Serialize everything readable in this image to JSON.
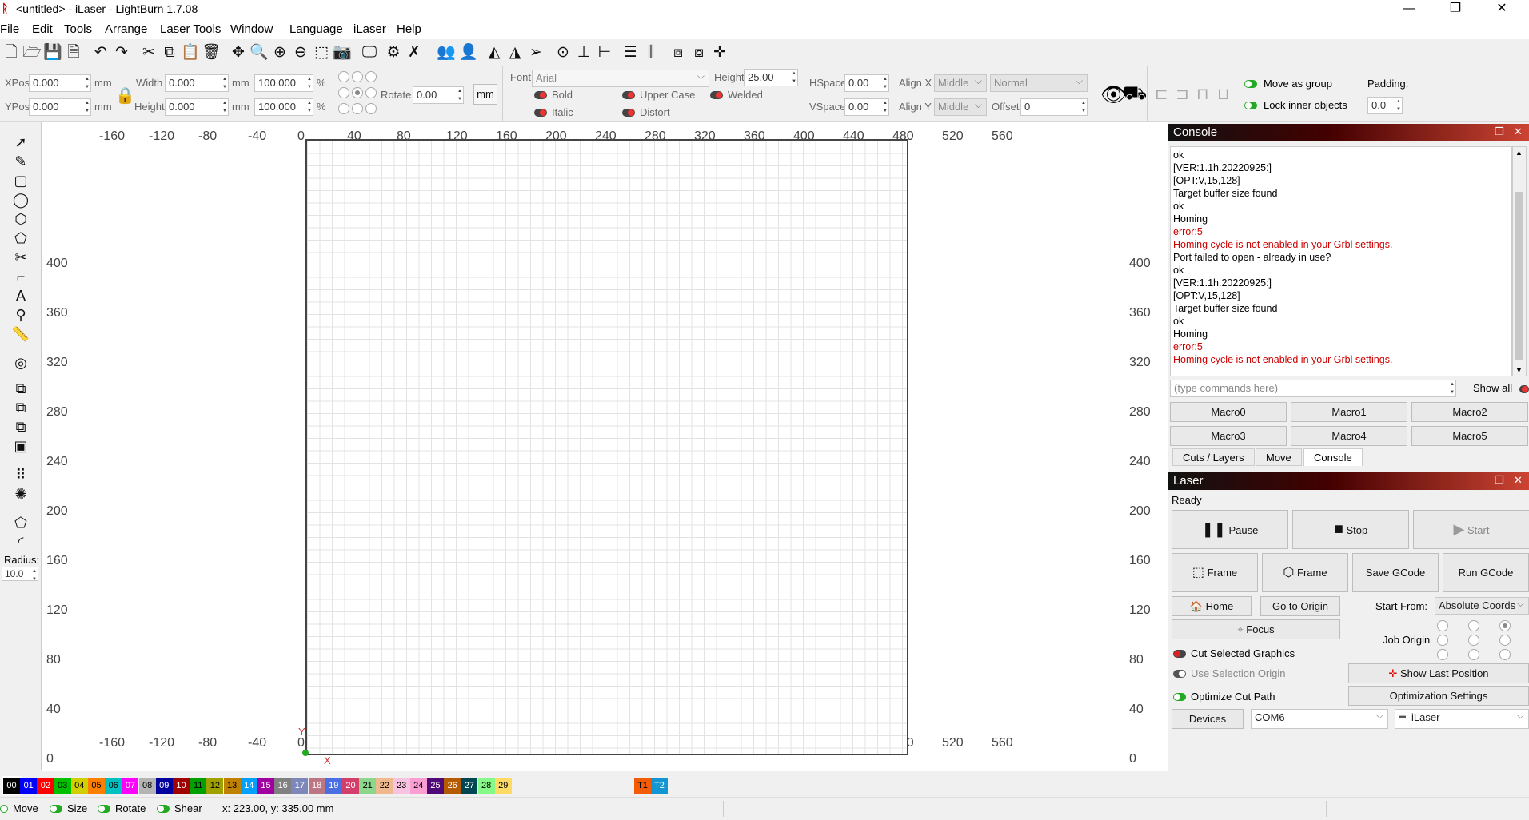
{
  "window": {
    "title": "<untitled> - iLaser - LightBurn 1.7.08",
    "minimize": "—",
    "restore": "❐",
    "close": "✕"
  },
  "menu": [
    "File",
    "Edit",
    "Tools",
    "Arrange",
    "Laser Tools",
    "Window",
    "Language",
    "iLaser",
    "Help"
  ],
  "toolbar_icons": [
    "new-file-icon",
    "open-folder-icon",
    "save-icon",
    "save-as-icon",
    "undo-icon",
    "redo-icon",
    "cut-icon",
    "copy-icon",
    "paste-icon",
    "delete-icon",
    "move-icon",
    "zoom-in-icon",
    "zoom-fit-icon",
    "zoom-out-icon",
    "zoom-selection-icon",
    "frame-select-icon",
    "camera-icon",
    "monitor-icon",
    "settings-gear-icon",
    "tools-icon",
    "group-icon",
    "user-icon",
    "mirror-icon",
    "flip-icon",
    "send-icon",
    "target-icon",
    "align-center-icon",
    "align-middle-icon",
    "distribute-h-icon",
    "distribute-v-icon",
    "space-icon",
    "crosshair-icon"
  ],
  "position": {
    "xpos_label": "XPos",
    "xpos": "0.000",
    "ypos_label": "YPos",
    "ypos": "0.000",
    "unit": "mm"
  },
  "size": {
    "width_label": "Width",
    "width": "0.000",
    "height_label": "Height",
    "height": "0.000",
    "unit": "mm",
    "w_pct": "100.000",
    "h_pct": "100.000",
    "pct": "%"
  },
  "rotate": {
    "label": "Rotate",
    "value": "0.00",
    "unit_btn": "mm"
  },
  "font": {
    "label": "Font",
    "value": "Arial",
    "height_label": "Height",
    "height": "25.00",
    "bold": "Bold",
    "italic": "Italic",
    "upper_case": "Upper Case",
    "distort": "Distort",
    "welded": "Welded"
  },
  "spacing": {
    "hspace_label": "HSpace",
    "hspace": "0.00",
    "vspace_label": "VSpace",
    "vspace": "0.00",
    "alignx_label": "Align X",
    "alignx": "Middle",
    "aligny_label": "Align Y",
    "aligny": "Middle",
    "style": "Normal",
    "offset_label": "Offset",
    "offset": "0"
  },
  "group": {
    "move_as_group": "Move as group",
    "lock_inner": "Lock inner objects",
    "padding_label": "Padding:",
    "padding": "0.0"
  },
  "left_tools": {
    "radius_label": "Radius:",
    "radius": "10.0"
  },
  "ruler": {
    "top": [
      "-160",
      "-120",
      "-80",
      "-40",
      "0",
      "40",
      "80",
      "120",
      "160",
      "200",
      "240",
      "280",
      "320",
      "360",
      "400",
      "440",
      "480",
      "520",
      "560"
    ],
    "left": [
      "400",
      "360",
      "320",
      "280",
      "240",
      "200",
      "160",
      "120",
      "80",
      "40",
      "0"
    ],
    "axis_y": "Y",
    "axis_x": "X"
  },
  "console": {
    "title": "Console",
    "lines": [
      {
        "t": "ok",
        "err": false
      },
      {
        "t": "[VER:1.1h.20220925:]",
        "err": false
      },
      {
        "t": "[OPT:V,15,128]",
        "err": false
      },
      {
        "t": "Target buffer size found",
        "err": false
      },
      {
        "t": "ok",
        "err": false
      },
      {
        "t": "Homing",
        "err": false
      },
      {
        "t": "error:5",
        "err": true
      },
      {
        "t": "Homing cycle is not enabled in your Grbl settings.",
        "err": true
      },
      {
        "t": "Port failed to open - already in use?",
        "err": false
      },
      {
        "t": "ok",
        "err": false
      },
      {
        "t": "[VER:1.1h.20220925:]",
        "err": false
      },
      {
        "t": "[OPT:V,15,128]",
        "err": false
      },
      {
        "t": "Target buffer size found",
        "err": false
      },
      {
        "t": "ok",
        "err": false
      },
      {
        "t": "Homing",
        "err": false
      },
      {
        "t": "error:5",
        "err": true
      },
      {
        "t": "Homing cycle is not enabled in your Grbl settings.",
        "err": true
      }
    ],
    "input_placeholder": "(type commands here)",
    "show_all": "Show all",
    "macros": [
      "Macro0",
      "Macro1",
      "Macro2",
      "Macro3",
      "Macro4",
      "Macro5"
    ],
    "tabs": [
      "Cuts / Layers",
      "Move",
      "Console"
    ]
  },
  "laser": {
    "title": "Laser",
    "status": "Ready",
    "pause": "Pause",
    "stop": "Stop",
    "start": "Start",
    "frame1": "Frame",
    "frame2": "Frame",
    "save_gcode": "Save GCode",
    "run_gcode": "Run GCode",
    "home": "Home",
    "go_to_origin": "Go to Origin",
    "start_from_label": "Start From:",
    "start_from": "Absolute Coords",
    "focus": "Focus",
    "job_origin_label": "Job Origin",
    "cut_selected": "Cut Selected Graphics",
    "use_selection_origin": "Use Selection Origin",
    "show_last_position": "Show Last Position",
    "optimize_cut_path": "Optimize Cut Path",
    "optimization_settings": "Optimization Settings",
    "devices": "Devices",
    "port": "COM6",
    "device": "iLaser"
  },
  "palette": [
    {
      "n": "00",
      "c": "#000000",
      "fg": "#ffffff"
    },
    {
      "n": "01",
      "c": "#0000ff",
      "fg": "#ffffff"
    },
    {
      "n": "02",
      "c": "#ff0000",
      "fg": "#ffffff"
    },
    {
      "n": "03",
      "c": "#00c000",
      "fg": "#000000"
    },
    {
      "n": "04",
      "c": "#d0d000",
      "fg": "#000000"
    },
    {
      "n": "05",
      "c": "#ff8000",
      "fg": "#000000"
    },
    {
      "n": "06",
      "c": "#00c0c0",
      "fg": "#000000"
    },
    {
      "n": "07",
      "c": "#ff00ff",
      "fg": "#ffffff"
    },
    {
      "n": "08",
      "c": "#b4b4b4",
      "fg": "#000000"
    },
    {
      "n": "09",
      "c": "#0000a0",
      "fg": "#ffffff"
    },
    {
      "n": "10",
      "c": "#a00000",
      "fg": "#ffffff"
    },
    {
      "n": "11",
      "c": "#00a000",
      "fg": "#000000"
    },
    {
      "n": "12",
      "c": "#a0a000",
      "fg": "#000000"
    },
    {
      "n": "13",
      "c": "#c08000",
      "fg": "#000000"
    },
    {
      "n": "14",
      "c": "#00a0ff",
      "fg": "#ffffff"
    },
    {
      "n": "15",
      "c": "#a000a0",
      "fg": "#ffffff"
    },
    {
      "n": "16",
      "c": "#808080",
      "fg": "#ffffff"
    },
    {
      "n": "17",
      "c": "#7d87b9",
      "fg": "#ffffff"
    },
    {
      "n": "18",
      "c": "#bb7784",
      "fg": "#ffffff"
    },
    {
      "n": "19",
      "c": "#4a6fe3",
      "fg": "#ffffff"
    },
    {
      "n": "20",
      "c": "#d33f6a",
      "fg": "#ffffff"
    },
    {
      "n": "21",
      "c": "#8cd78c",
      "fg": "#000000"
    },
    {
      "n": "22",
      "c": "#f0b98d",
      "fg": "#000000"
    },
    {
      "n": "23",
      "c": "#f6c4e1",
      "fg": "#000000"
    },
    {
      "n": "24",
      "c": "#fa9ed4",
      "fg": "#000000"
    },
    {
      "n": "25",
      "c": "#500a78",
      "fg": "#ffffff"
    },
    {
      "n": "26",
      "c": "#b45a00",
      "fg": "#ffffff"
    },
    {
      "n": "27",
      "c": "#004754",
      "fg": "#ffffff"
    },
    {
      "n": "28",
      "c": "#86fa88",
      "fg": "#000000"
    },
    {
      "n": "29",
      "c": "#ffdb66",
      "fg": "#000000"
    },
    {
      "n": "T1",
      "c": "#f35b06",
      "fg": "#000000"
    },
    {
      "n": "T2",
      "c": "#1196d3",
      "fg": "#ffffff"
    }
  ],
  "status": {
    "move": "Move",
    "size": "Size",
    "rotate": "Rotate",
    "shear": "Shear",
    "coords": "x: 223.00, y: 335.00 mm"
  }
}
